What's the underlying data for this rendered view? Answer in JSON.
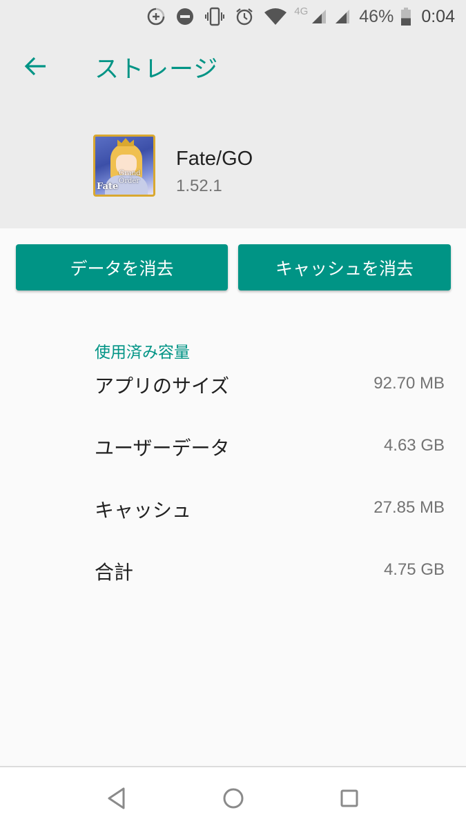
{
  "status_bar": {
    "network_type": "4G",
    "battery_percent": "46%",
    "battery_level": 0.46,
    "time": "0:04",
    "icons": [
      "data-saver-icon",
      "do-not-disturb-icon",
      "vibrate-icon",
      "alarm-icon",
      "wifi-icon",
      "signal-icon",
      "signal-icon",
      "battery-icon"
    ]
  },
  "header": {
    "back_icon": "arrow-back-icon",
    "title": "ストレージ"
  },
  "app": {
    "name": "Fate/GO",
    "version": "1.52.1",
    "icon_logo_main": "Fate",
    "icon_logo_sub": "Grand Order"
  },
  "actions": {
    "clear_data_label": "データを消去",
    "clear_cache_label": "キャッシュを消去"
  },
  "storage": {
    "section_title": "使用済み容量",
    "rows": [
      {
        "label": "アプリのサイズ",
        "value": "92.70 MB"
      },
      {
        "label": "ユーザーデータ",
        "value": "4.63 GB"
      },
      {
        "label": "キャッシュ",
        "value": "27.85 MB"
      },
      {
        "label": "合計",
        "value": "4.75 GB"
      }
    ]
  },
  "nav_bar": {
    "buttons": [
      "back-triangle-icon",
      "home-circle-icon",
      "recents-square-icon"
    ]
  },
  "colors": {
    "accent": "#009485",
    "header_bg": "#ececec",
    "body_bg": "#fafafa"
  }
}
